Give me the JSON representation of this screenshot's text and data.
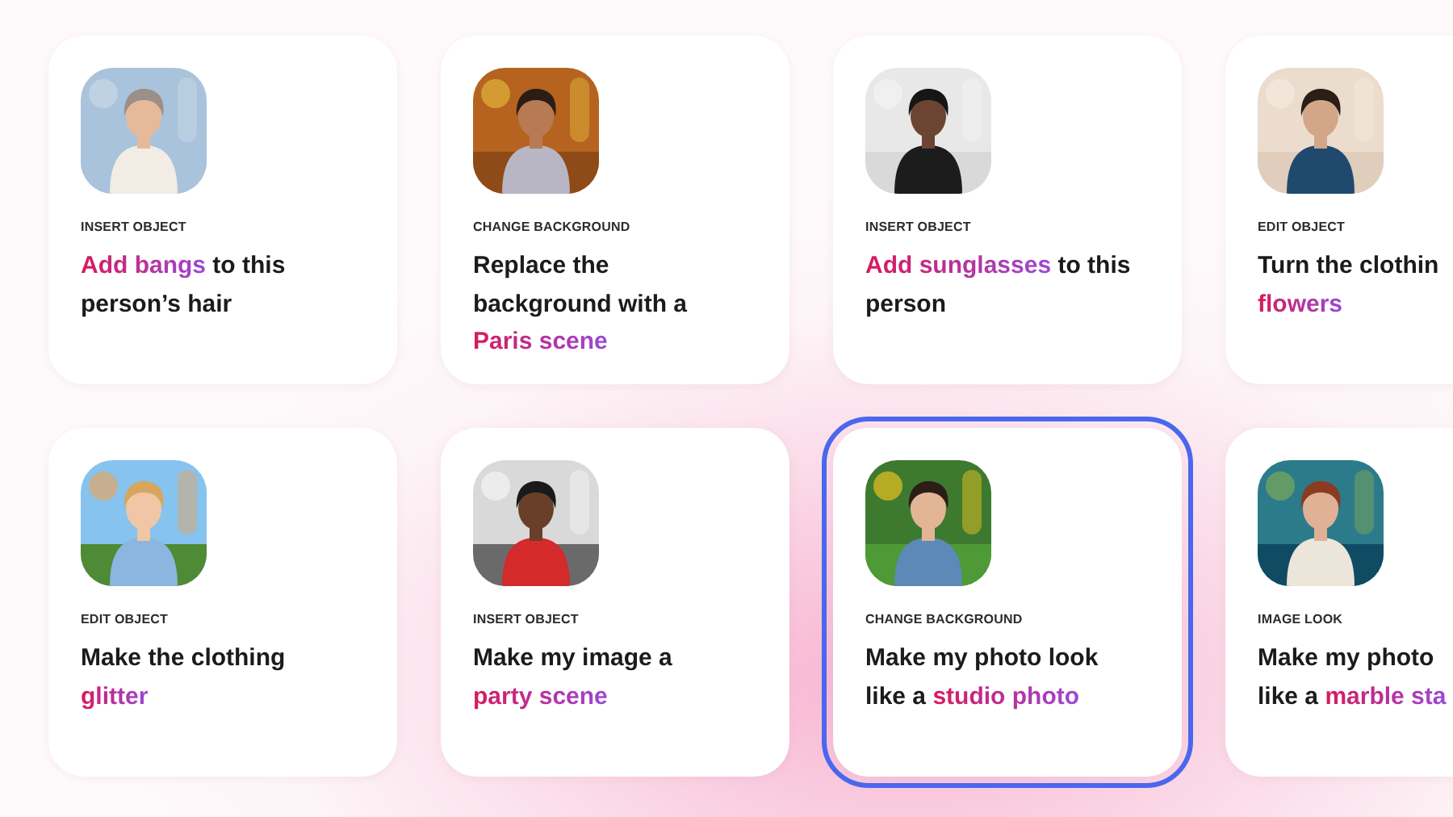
{
  "cards": [
    {
      "category": "INSERT OBJECT",
      "selected": false,
      "lines": [
        [
          {
            "text": "Add bangs",
            "highlight": true
          },
          {
            "text": " to this",
            "highlight": false
          }
        ],
        [
          {
            "text": "person’s hair",
            "highlight": false
          }
        ]
      ]
    },
    {
      "category": "CHANGE BACKGROUND",
      "selected": false,
      "lines": [
        [
          {
            "text": "Replace the",
            "highlight": false
          }
        ],
        [
          {
            "text": "background with a",
            "highlight": false
          }
        ],
        [
          {
            "text": "Paris scene",
            "highlight": true
          }
        ]
      ]
    },
    {
      "category": "INSERT OBJECT",
      "selected": false,
      "lines": [
        [
          {
            "text": "Add sunglasses",
            "highlight": true
          },
          {
            "text": " to this",
            "highlight": false
          }
        ],
        [
          {
            "text": "person",
            "highlight": false
          }
        ]
      ]
    },
    {
      "category": "EDIT OBJECT",
      "selected": false,
      "lines": [
        [
          {
            "text": "Turn the clothin",
            "highlight": false
          }
        ],
        [
          {
            "text": "flowers",
            "highlight": true
          }
        ]
      ]
    },
    {
      "category": "EDIT OBJECT",
      "selected": false,
      "lines": [
        [
          {
            "text": "Make the clothing",
            "highlight": false
          }
        ],
        [
          {
            "text": "glitter",
            "highlight": true
          }
        ]
      ]
    },
    {
      "category": "INSERT OBJECT",
      "selected": false,
      "lines": [
        [
          {
            "text": "Make my image a",
            "highlight": false
          }
        ],
        [
          {
            "text": "party scene",
            "highlight": true
          }
        ]
      ]
    },
    {
      "category": "CHANGE BACKGROUND",
      "selected": true,
      "lines": [
        [
          {
            "text": "Make my photo look",
            "highlight": false
          }
        ],
        [
          {
            "text": "like a ",
            "highlight": false
          },
          {
            "text": "studio photo",
            "highlight": true
          }
        ]
      ]
    },
    {
      "category": "IMAGE LOOK",
      "selected": false,
      "lines": [
        [
          {
            "text": "Make my photo",
            "highlight": false
          }
        ],
        [
          {
            "text": "like a ",
            "highlight": false
          },
          {
            "text": "marble sta",
            "highlight": true
          }
        ]
      ]
    }
  ]
}
